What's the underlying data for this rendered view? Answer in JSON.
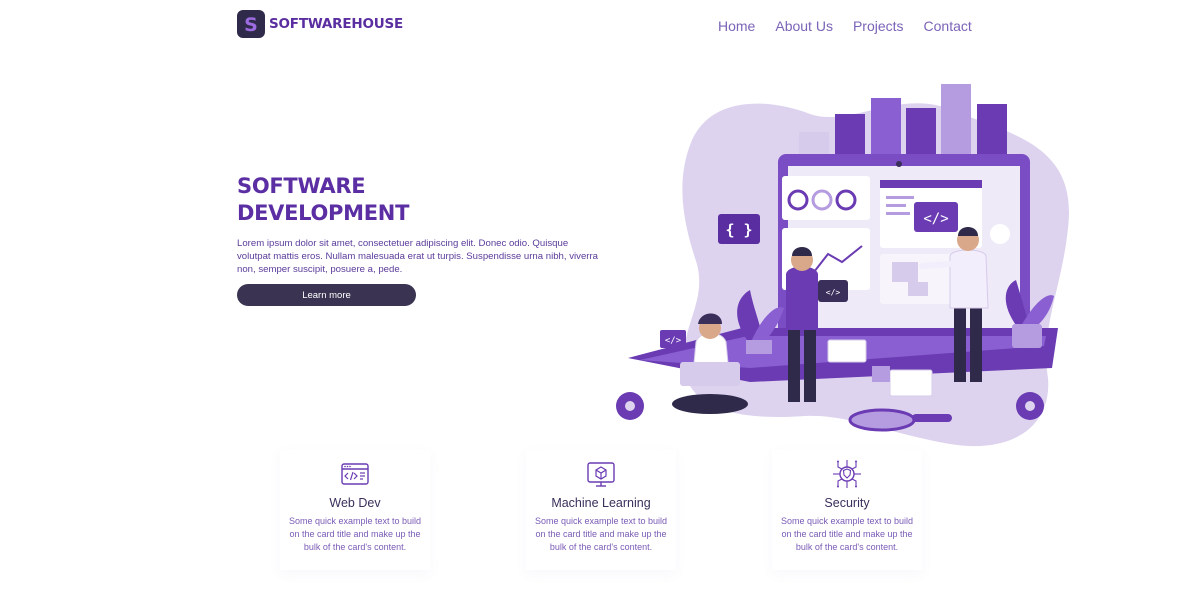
{
  "brand": {
    "logo_letter": "S",
    "name": "SOFTWAREHOUSE",
    "colors": {
      "primary": "#5b2fa3",
      "dark": "#2f2a4a",
      "accent": "#7b63b8",
      "light": "#ddd3ef"
    }
  },
  "nav": {
    "items": [
      {
        "label": "Home"
      },
      {
        "label": "About Us"
      },
      {
        "label": "Projects"
      },
      {
        "label": "Contact"
      }
    ]
  },
  "hero": {
    "title_line1": "SOFTWARE",
    "title_line2": "DEVELOPMENT",
    "body": "Lorem ipsum dolor sit amet, consectetuer adipiscing elit. Donec odio. Quisque volutpat mattis eros. Nullam malesuada erat ut turpis. Suspendisse urna nibh, viverra non, semper suscipit, posuere a, pede.",
    "button_label": "Learn more",
    "illustration": {
      "code_badge_left": "{ }",
      "code_badge": "</>"
    }
  },
  "cards": [
    {
      "icon": "code-window-icon",
      "title": "Web Dev",
      "text": "Some quick example text to build on the card title and make up the bulk of the card's content."
    },
    {
      "icon": "monitor-cube-icon",
      "title": "Machine Learning",
      "text": "Some quick example text to build on the card title and make up the bulk of the card's content."
    },
    {
      "icon": "shield-circuit-icon",
      "title": "Security",
      "text": "Some quick example text to build on the card title and make up the bulk of the card's content."
    }
  ]
}
